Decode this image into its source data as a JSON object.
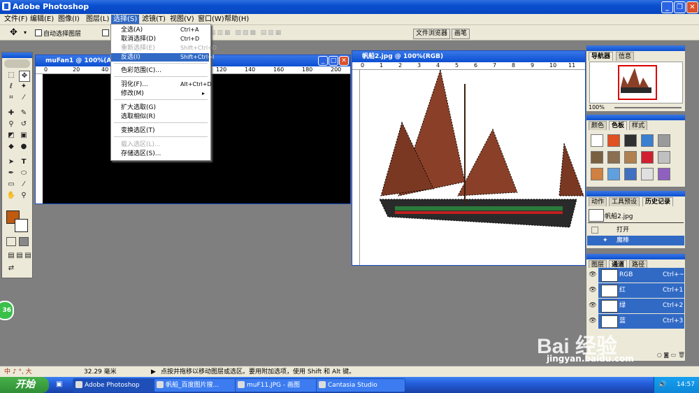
{
  "window": {
    "title": "Adobe Photoshop"
  },
  "menubar": [
    "文件(F)",
    "编辑(E)",
    "图像(I)",
    "图层(L)",
    "选择(S)",
    "滤镜(T)",
    "视图(V)",
    "窗口(W)",
    "帮助(H)"
  ],
  "options": {
    "auto_select_label": "自动选择图层",
    "file_browser_tab": "文件浏览器",
    "brushes_tab": "画笔"
  },
  "select_menu": [
    {
      "label": "全选(A)",
      "shortcut": "Ctrl+A",
      "state": "normal"
    },
    {
      "label": "取消选择(D)",
      "shortcut": "Ctrl+D",
      "state": "normal"
    },
    {
      "label": "重新选择(E)",
      "shortcut": "Shift+Ctrl+D",
      "state": "disabled"
    },
    {
      "label": "反选(I)",
      "shortcut": "Shift+Ctrl+I",
      "state": "highlighted"
    },
    {
      "label": "色彩范围(C)...",
      "shortcut": "",
      "state": "normal"
    },
    {
      "label": "羽化(F)...",
      "shortcut": "Alt+Ctrl+D",
      "state": "normal"
    },
    {
      "label": "修改(M)",
      "shortcut": "▸",
      "state": "normal"
    },
    {
      "label": "扩大选取(G)",
      "shortcut": "",
      "state": "normal"
    },
    {
      "label": "选取相似(R)",
      "shortcut": "",
      "state": "normal"
    },
    {
      "label": "变换选区(T)",
      "shortcut": "",
      "state": "normal"
    },
    {
      "label": "载入选区(L)...",
      "shortcut": "",
      "state": "disabled"
    },
    {
      "label": "存储选区(S)...",
      "shortcut": "",
      "state": "normal"
    }
  ],
  "doc1": {
    "title": "muFan1 @ 100%(A",
    "ruler": [
      "0",
      "20",
      "40",
      "60",
      "80",
      "100",
      "120",
      "140",
      "160",
      "180",
      "200"
    ]
  },
  "doc2": {
    "title": "帆船2.jpg @ 100%(RGB)",
    "ruler": [
      "0",
      "1",
      "2",
      "3",
      "4",
      "5",
      "6",
      "7",
      "8",
      "9",
      "10",
      "11"
    ]
  },
  "navigator": {
    "tabs": [
      "导航器",
      "信息"
    ],
    "zoom": "100%"
  },
  "swatches": {
    "tabs": [
      "颜色",
      "色板",
      "样式"
    ],
    "colors": [
      "#ffffff",
      "#e05020",
      "#303030",
      "#3a7fd0",
      "#9a9a9a",
      "#7a6040",
      "#8a7050",
      "#b08050",
      "#d02030",
      "#c0c0c0",
      "#d08040",
      "#60a0e0",
      "#4070c0",
      "#e0e0e0",
      "#9060c0"
    ]
  },
  "history": {
    "tabs": [
      "动作",
      "工具预设",
      "历史记录"
    ],
    "snapshot": "帆船2.jpg",
    "items": [
      {
        "label": "打开",
        "selected": false
      },
      {
        "label": "魔棒",
        "selected": true
      }
    ]
  },
  "channels": {
    "tabs": [
      "图层",
      "通道",
      "路径"
    ],
    "rows": [
      {
        "name": "RGB",
        "shortcut": "Ctrl+~"
      },
      {
        "name": "红",
        "shortcut": "Ctrl+1"
      },
      {
        "name": "绿",
        "shortcut": "Ctrl+2"
      },
      {
        "name": "蓝",
        "shortcut": "Ctrl+3"
      }
    ]
  },
  "status": {
    "ime": "中 ♪ °, 大",
    "measure": "32.29 毫米",
    "hint": "点按并拖移以移动图层或选区。要用附加选项，使用 Shift 和 Alt 键。"
  },
  "taskbar": {
    "start": "开始",
    "tasks": [
      "Adobe Photoshop",
      "帆船_百度图片搜...",
      "muF11.JPG - 画图",
      "Cantasia Studio"
    ],
    "clock": "14:57"
  },
  "badge": "36",
  "watermark": {
    "brand": "Bai 经验",
    "url": "jingyan.baidu.com"
  },
  "colors": {
    "titlebar": "#0a4fd0",
    "highlight": "#316ac5",
    "foreground_color": "#c05a10",
    "workspace": "#7f7f7f"
  }
}
